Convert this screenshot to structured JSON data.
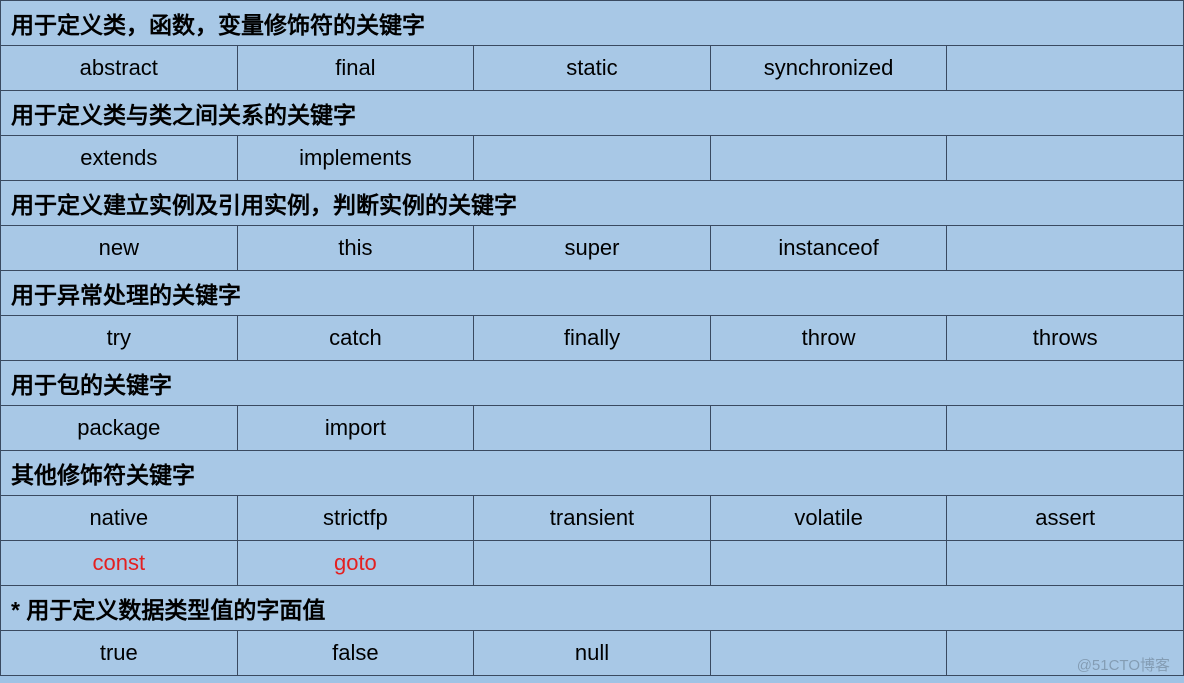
{
  "sections": [
    {
      "header": "用于定义类，函数，变量修饰符的关键字",
      "rows": [
        [
          "abstract",
          "final",
          "static",
          "synchronized",
          ""
        ]
      ]
    },
    {
      "header": "用于定义类与类之间关系的关键字",
      "rows": [
        [
          "extends",
          "implements",
          "",
          "",
          ""
        ]
      ]
    },
    {
      "header": "用于定义建立实例及引用实例，判断实例的关键字",
      "rows": [
        [
          "new",
          "this",
          "super",
          "instanceof",
          ""
        ]
      ]
    },
    {
      "header": "用于异常处理的关键字",
      "rows": [
        [
          "try",
          "catch",
          "finally",
          "throw",
          "throws"
        ]
      ]
    },
    {
      "header": "用于包的关键字",
      "rows": [
        [
          "package",
          "import",
          "",
          "",
          ""
        ]
      ]
    },
    {
      "header": "其他修饰符关键字",
      "rows": [
        [
          "native",
          "strictfp",
          "transient",
          "volatile",
          "assert"
        ],
        [
          "const",
          "goto",
          "",
          "",
          ""
        ]
      ],
      "redRowIndex": 1
    },
    {
      "header": "* 用于定义数据类型值的字面值",
      "rows": [
        [
          "true",
          "false",
          "null",
          "",
          ""
        ]
      ]
    }
  ],
  "watermark": "@51CTO博客"
}
